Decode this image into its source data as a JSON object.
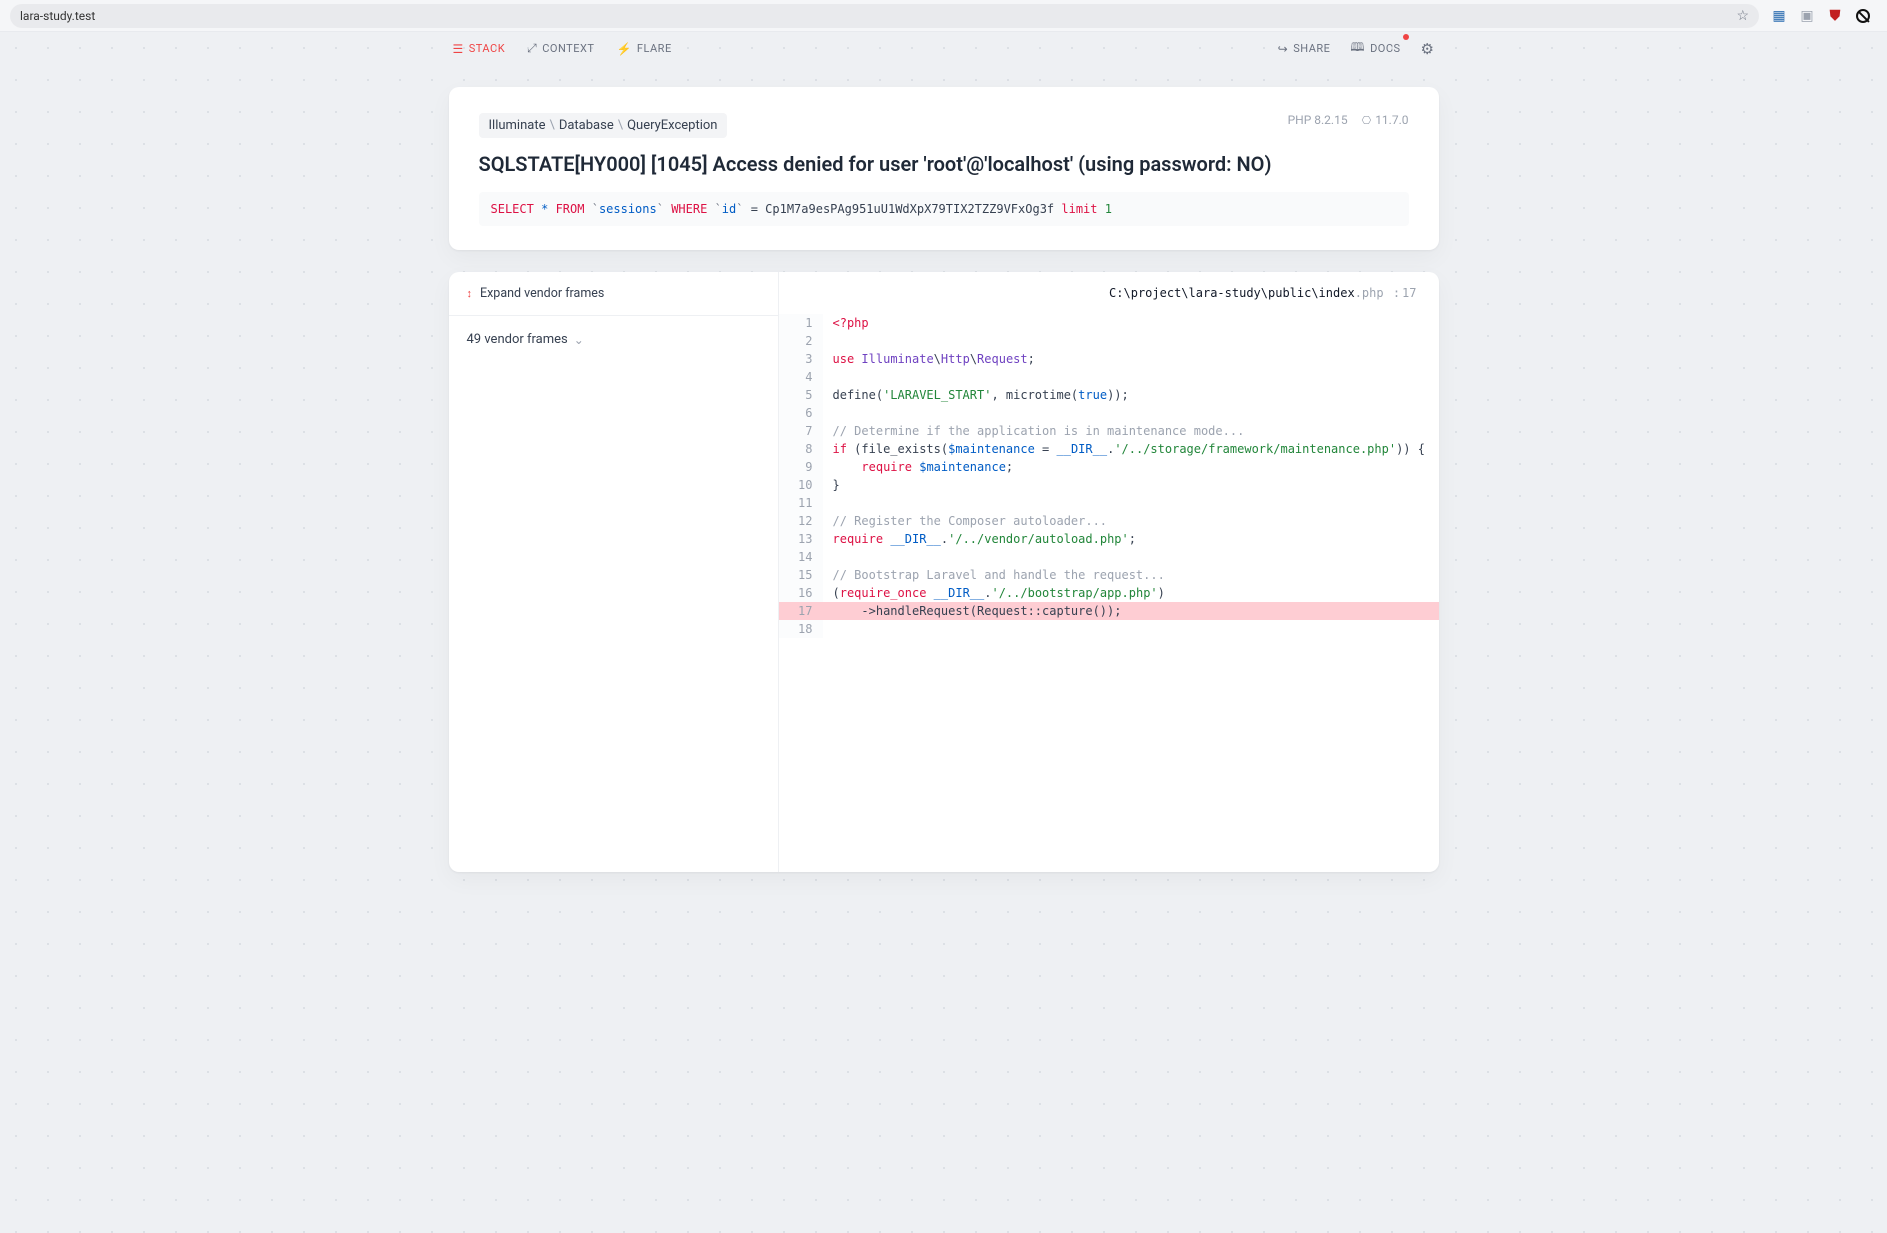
{
  "browser": {
    "url": "lara-study.test"
  },
  "nav": {
    "stack": "STACK",
    "context": "CONTEXT",
    "flare": "FLARE",
    "share": "SHARE",
    "docs": "DOCS"
  },
  "header": {
    "namespace": [
      "Illuminate",
      "Database",
      "QueryException"
    ],
    "php_version": "PHP 8.2.15",
    "laravel_version": "11.7.0",
    "title": "SQLSTATE[HY000] [1045] Access denied for user 'root'@'localhost' (using password: NO)"
  },
  "sql": {
    "raw": "SELECT * FROM `sessions` WHERE `id` = Cp1M7a9esPAg951uU1WdXpX79TIX2TZZ9VFxOg3f limit 1"
  },
  "frames": {
    "expand_label": "Expand vendor frames",
    "vendor_count_label": "49 vendor frames"
  },
  "source": {
    "file_path": "C:\\project\\lara-study\\public\\index",
    "file_ext": ".php",
    "highlight_line": 17,
    "lines": [
      {
        "n": 1,
        "html": "<span class='c-key'>&lt;?php</span>"
      },
      {
        "n": 2,
        "html": ""
      },
      {
        "n": 3,
        "html": "<span class='c-key'>use</span> <span class='c-ns'>Illuminate</span>\\<span class='c-ns'>Http</span>\\<span class='c-ns'>Request</span>;"
      },
      {
        "n": 4,
        "html": ""
      },
      {
        "n": 5,
        "html": "define(<span class='c-str'>'LARAVEL_START'</span>, microtime(<span class='c-const'>true</span>));"
      },
      {
        "n": 6,
        "html": ""
      },
      {
        "n": 7,
        "html": "<span class='c-comment'>// Determine if the application is in maintenance mode...</span>"
      },
      {
        "n": 8,
        "html": "<span class='c-key'>if</span> (file_exists(<span class='c-var'>$maintenance</span> = <span class='c-const'>__DIR__</span>.<span class='c-str'>'/../storage/framework/maintenance.php'</span>)) {"
      },
      {
        "n": 9,
        "html": "    <span class='c-key'>require</span> <span class='c-var'>$maintenance</span>;"
      },
      {
        "n": 10,
        "html": "}"
      },
      {
        "n": 11,
        "html": ""
      },
      {
        "n": 12,
        "html": "<span class='c-comment'>// Register the Composer autoloader...</span>"
      },
      {
        "n": 13,
        "html": "<span class='c-key'>require</span> <span class='c-const'>__DIR__</span>.<span class='c-str'>'/../vendor/autoload.php'</span>;"
      },
      {
        "n": 14,
        "html": ""
      },
      {
        "n": 15,
        "html": "<span class='c-comment'>// Bootstrap Laravel and handle the request...</span>"
      },
      {
        "n": 16,
        "html": "(<span class='c-key'>require_once</span> <span class='c-const'>__DIR__</span>.<span class='c-str'>'/../bootstrap/app.php'</span>)"
      },
      {
        "n": 17,
        "html": "    -&gt;handleRequest(Request::capture());"
      },
      {
        "n": 18,
        "html": ""
      }
    ]
  }
}
